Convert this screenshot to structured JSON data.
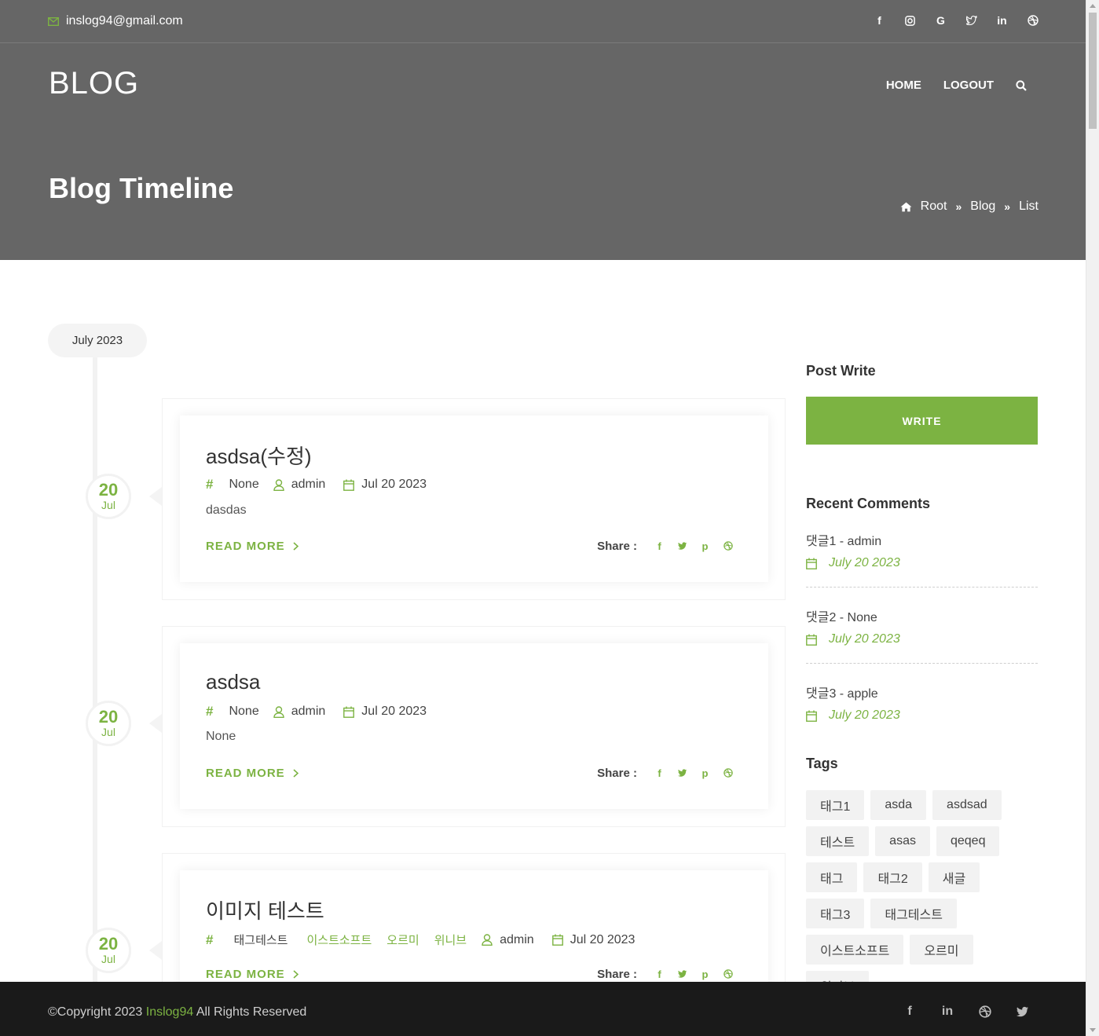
{
  "topbar": {
    "email": "inslog94@gmail.com",
    "social": [
      "facebook-icon",
      "instagram-icon",
      "google-icon",
      "twitter-icon",
      "linkedin-icon",
      "dribbble-icon"
    ]
  },
  "header": {
    "logo": "BLOG",
    "nav": {
      "home": "HOME",
      "logout": "LOGOUT"
    },
    "page_title": "Blog Timeline",
    "breadcrumb": {
      "root": "Root",
      "blog": "Blog",
      "list": "List"
    }
  },
  "timeline": {
    "month": "July 2023",
    "posts": [
      {
        "day": "20",
        "month": "Jul",
        "title": "asdsa(수정)",
        "tags": [
          "None"
        ],
        "author": "admin",
        "date": "Jul 20 2023",
        "excerpt": "dasdas",
        "read_more": "READ MORE",
        "share_label": "Share :"
      },
      {
        "day": "20",
        "month": "Jul",
        "title": "asdsa",
        "tags": [
          "None"
        ],
        "author": "admin",
        "date": "Jul 20 2023",
        "excerpt": "None",
        "read_more": "READ MORE",
        "share_label": "Share :"
      },
      {
        "day": "20",
        "month": "Jul",
        "title": "이미지 테스트",
        "tags": [
          "태그테스트",
          "이스트소프트",
          "오르미",
          "위니브"
        ],
        "author": "admin",
        "date": "Jul 20 2023",
        "excerpt": "",
        "read_more": "READ MORE",
        "share_label": "Share :"
      }
    ]
  },
  "sidebar": {
    "post_write_title": "Post Write",
    "write_button": "WRITE",
    "recent_comments_title": "Recent Comments",
    "comments": [
      {
        "who": "댓글1 - admin",
        "date": "July 20 2023"
      },
      {
        "who": "댓글2 - None",
        "date": "July 20 2023"
      },
      {
        "who": "댓글3 - apple",
        "date": "July 20 2023"
      }
    ],
    "tags_title": "Tags",
    "tags": [
      "태그1",
      "asda",
      "asdsad",
      "테스트",
      "asas",
      "qeqeq",
      "태그",
      "태그2",
      "새글",
      "태그3",
      "태그테스트",
      "이스트소프트",
      "오르미",
      "위니브"
    ]
  },
  "footer": {
    "copy_prefix": "©Copyright 2023 ",
    "brand": "Inslog94",
    "copy_suffix": " All Rights Reserved",
    "social": [
      "facebook-icon",
      "linkedin-icon",
      "dribbble-icon",
      "twitter-icon"
    ]
  },
  "colors": {
    "accent": "#7cb342",
    "header_bg": "#666666",
    "footer_bg": "#1a1a1a"
  }
}
